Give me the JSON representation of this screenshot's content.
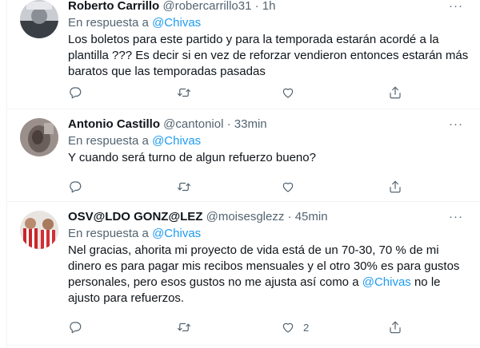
{
  "tweets": [
    {
      "name": "Roberto Carrillo",
      "handle": "@robercarrillo31",
      "time": "· 1h",
      "reply_prefix": "En respuesta a",
      "reply_to": "@Chivas",
      "text": "Los boletos para este partido y para la temporada estarán acordé a la plantilla ??? Es decir si en vez de reforzar vendieron entonces estarán más baratos que las temporadas pasadas",
      "more": "···",
      "likes": ""
    },
    {
      "name": "Antonio Castillo",
      "handle": "@cantoniol",
      "time": "· 33min",
      "reply_prefix": "En respuesta a",
      "reply_to": "@Chivas",
      "text": "Y cuando será turno de algun refuerzo bueno?",
      "more": "···",
      "likes": ""
    },
    {
      "name": "OSV@LDO GONZ@LEZ",
      "handle": "@moisesglezz",
      "time": "· 45min",
      "reply_prefix": "En respuesta a",
      "reply_to": "@Chivas",
      "text_before": "Nel gracias, ahorita mi proyecto de vida está de un 70-30, 70 % de mi dinero es para pagar mis recibos mensuales y el otro 30% es para gustos personales, pero esos gustos no me ajusta así como a ",
      "text_mention": "@Chivas",
      "text_after": " no le ajusto para refuerzos.",
      "more": "···",
      "likes": "2"
    }
  ],
  "icons": {
    "reply": "reply-icon",
    "retweet": "retweet-icon",
    "like": "heart-icon",
    "share": "share-icon"
  },
  "colors": {
    "accent": "#1d9bf0",
    "secondary_text": "#536471",
    "divider": "#eff3f4"
  }
}
